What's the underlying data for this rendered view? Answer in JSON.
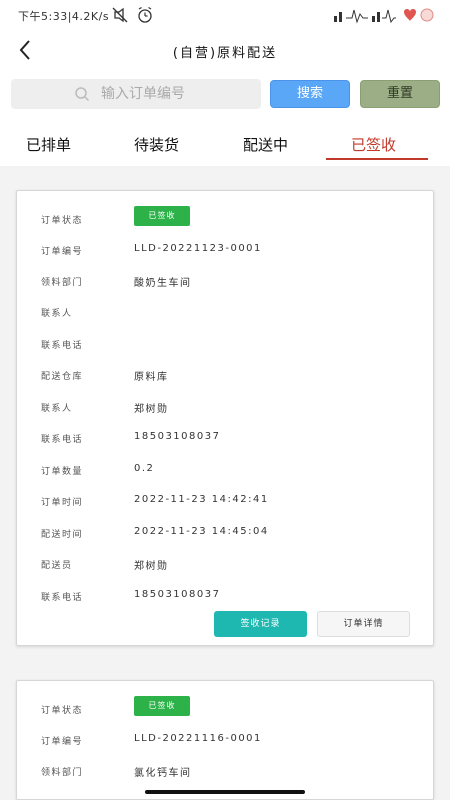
{
  "status_bar": {
    "time": "下午5:33|4.2K/s",
    "icons": [
      "mute-icon",
      "alarm-icon",
      "signal-icon",
      "heart-battery-icon"
    ]
  },
  "nav": {
    "title": "(自营)原料配送",
    "back_icon": "chevron-left-icon"
  },
  "search": {
    "placeholder": "输入订单编号",
    "value": "",
    "search_label": "搜索",
    "reset_label": "重置",
    "colors": {
      "search_bg": "#5aa6f7",
      "reset_bg": "#9bae85"
    }
  },
  "tabs": [
    {
      "label": "已排单",
      "active": false
    },
    {
      "label": "待装货",
      "active": false
    },
    {
      "label": "配送中",
      "active": false
    },
    {
      "label": "已签收",
      "active": true
    }
  ],
  "accent_color": "#c0392b",
  "orders": [
    {
      "status": {
        "label": "订单状态",
        "value": "已签收"
      },
      "fields": [
        {
          "label": "订单编号",
          "value": "LLD-20221123-0001"
        },
        {
          "label": "领料部门",
          "value": "酸奶生车间"
        },
        {
          "label": "联系人",
          "value": ""
        },
        {
          "label": "联系电话",
          "value": ""
        },
        {
          "label": "配送仓库",
          "value": "原料库"
        },
        {
          "label": "联系人",
          "value": "郑树勋"
        },
        {
          "label": "联系电话",
          "value": "18503108037"
        },
        {
          "label": "订单数量",
          "value": "0.2"
        },
        {
          "label": "订单时间",
          "value": "2022-11-23 14:42:41"
        },
        {
          "label": "配送时间",
          "value": "2022-11-23 14:45:04"
        },
        {
          "label": "配送员",
          "value": "郑树勋"
        },
        {
          "label": "联系电话",
          "value": "18503108037"
        }
      ],
      "actions": {
        "sign_record": "签收记录",
        "order_detail": "订单详情"
      }
    },
    {
      "status": {
        "label": "订单状态",
        "value": "已签收"
      },
      "fields": [
        {
          "label": "订单编号",
          "value": "LLD-20221116-0001"
        },
        {
          "label": "领料部门",
          "value": "氯化钙车间"
        }
      ]
    }
  ]
}
